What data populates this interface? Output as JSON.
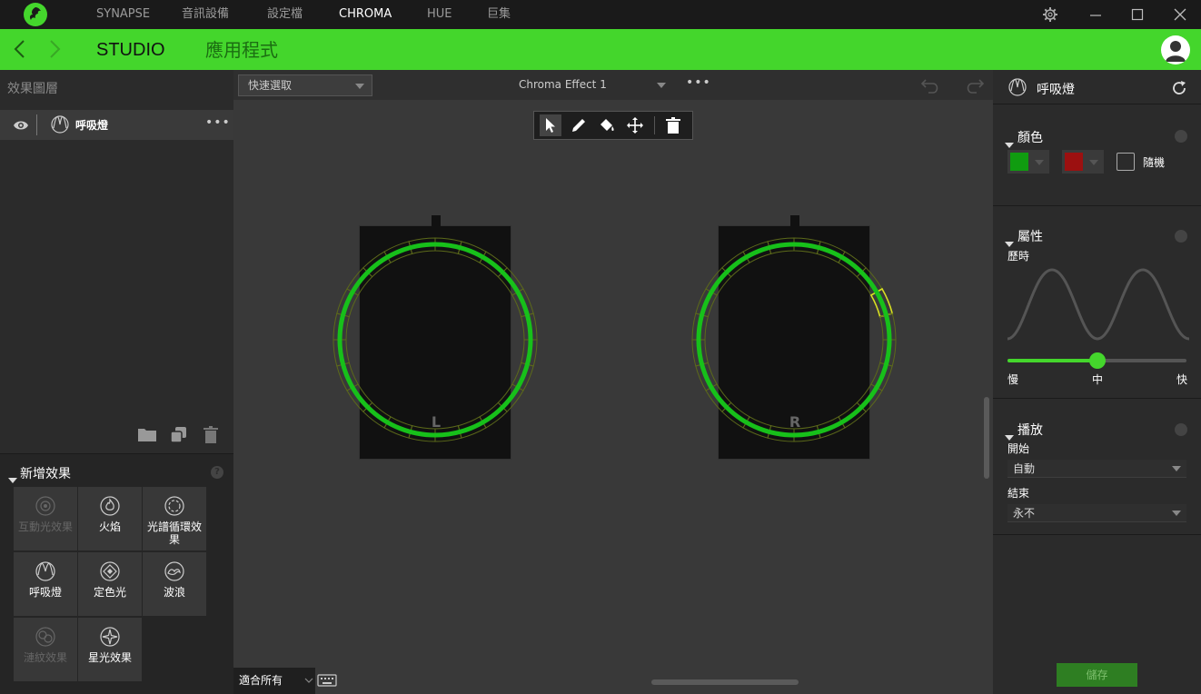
{
  "nav": {
    "tabs": [
      "SYNAPSE",
      "音訊設備",
      "設定檔",
      "CHROMA",
      "HUE",
      "巨集"
    ],
    "active_tab": "CHROMA"
  },
  "header": {
    "studio": "STUDIO",
    "apps": "應用程式"
  },
  "left": {
    "panel_title": "效果圖層",
    "layer": {
      "name": "呼吸燈",
      "more": "•••"
    },
    "add_effect": {
      "title": "新增效果",
      "help": "?",
      "effects": [
        {
          "label": "互動光效果",
          "icon": "reactive-icon",
          "enabled": false
        },
        {
          "label": "火焰",
          "icon": "fire-icon",
          "enabled": true
        },
        {
          "label": "光譜循環效果",
          "icon": "spectrum-icon",
          "enabled": true
        },
        {
          "label": "呼吸燈",
          "icon": "breathing-icon",
          "enabled": true
        },
        {
          "label": "定色光",
          "icon": "static-icon",
          "enabled": true
        },
        {
          "label": "波浪",
          "icon": "wave-icon",
          "enabled": true
        },
        {
          "label": "漣紋效果",
          "icon": "ripple-icon",
          "enabled": false
        },
        {
          "label": "星光效果",
          "icon": "starlight-icon",
          "enabled": true
        }
      ]
    }
  },
  "center": {
    "quick_select": "快速選取",
    "effect_name": "Chroma Effect 1",
    "more": "•••",
    "devices": [
      {
        "label": "L"
      },
      {
        "label": "R"
      }
    ],
    "fit": "適合所有"
  },
  "right": {
    "title": "呼吸燈",
    "colors": {
      "title": "顏色",
      "color1": "#109c10",
      "color2": "#9c1010",
      "random_label": "隨機"
    },
    "properties": {
      "title": "屬性",
      "duration_label": "歷時",
      "speed_value": 0.5,
      "slow": "慢",
      "mid": "中",
      "fast": "快"
    },
    "playback": {
      "title": "播放",
      "start_label": "開始",
      "start_value": "自動",
      "end_label": "結束",
      "end_value": "永不"
    },
    "save": "儲存"
  },
  "colors": {
    "accent": "#44d62c",
    "ring": "#17c01a",
    "selected_led": "#d8e022"
  }
}
